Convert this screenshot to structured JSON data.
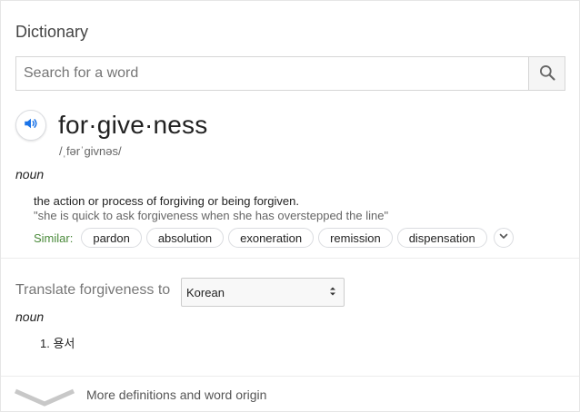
{
  "header": {
    "title": "Dictionary"
  },
  "search": {
    "placeholder": "Search for a word",
    "button_icon": "search-icon"
  },
  "entry": {
    "speaker_icon": "speaker-icon",
    "headword": "for·give·ness",
    "phonetic": "/ˌfərˈɡivnəs/",
    "part_of_speech": "noun",
    "definition": "the action or process of forgiving or being forgiven.",
    "example": "\"she is quick to ask forgiveness when she has overstepped the line\"",
    "similar_label": "Similar:",
    "similar": [
      "pardon",
      "absolution",
      "exoneration",
      "remission",
      "dispensation"
    ],
    "expand_icon": "chevron-down-icon"
  },
  "translate": {
    "label": "Translate forgiveness to",
    "language": "Korean",
    "part_of_speech": "noun",
    "items": [
      "1. 용서"
    ]
  },
  "footer": {
    "more_label": "More definitions and word origin",
    "chevron_icon": "chevron-down-icon"
  },
  "colors": {
    "accent_blue": "#1a73e8",
    "similar_green": "#4a8a3a"
  }
}
